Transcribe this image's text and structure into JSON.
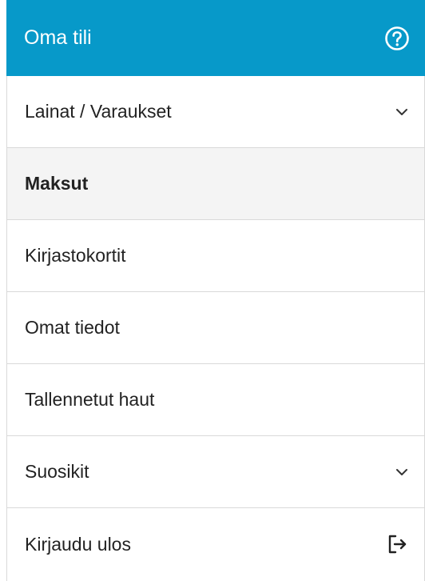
{
  "header": {
    "title": "Oma tili",
    "help_icon": "question-circle-icon",
    "background_color": "#0799c9"
  },
  "menu": {
    "items": [
      {
        "label": "Lainat / Varaukset",
        "icon": "chevron-down-icon",
        "active": false
      },
      {
        "label": "Maksut",
        "icon": "",
        "active": true
      },
      {
        "label": "Kirjastokortit",
        "icon": "",
        "active": false
      },
      {
        "label": "Omat tiedot",
        "icon": "",
        "active": false
      },
      {
        "label": "Tallennetut haut",
        "icon": "",
        "active": false
      },
      {
        "label": "Suosikit",
        "icon": "chevron-down-icon",
        "active": false
      },
      {
        "label": "Kirjaudu ulos",
        "icon": "logout-icon",
        "active": false
      }
    ]
  }
}
